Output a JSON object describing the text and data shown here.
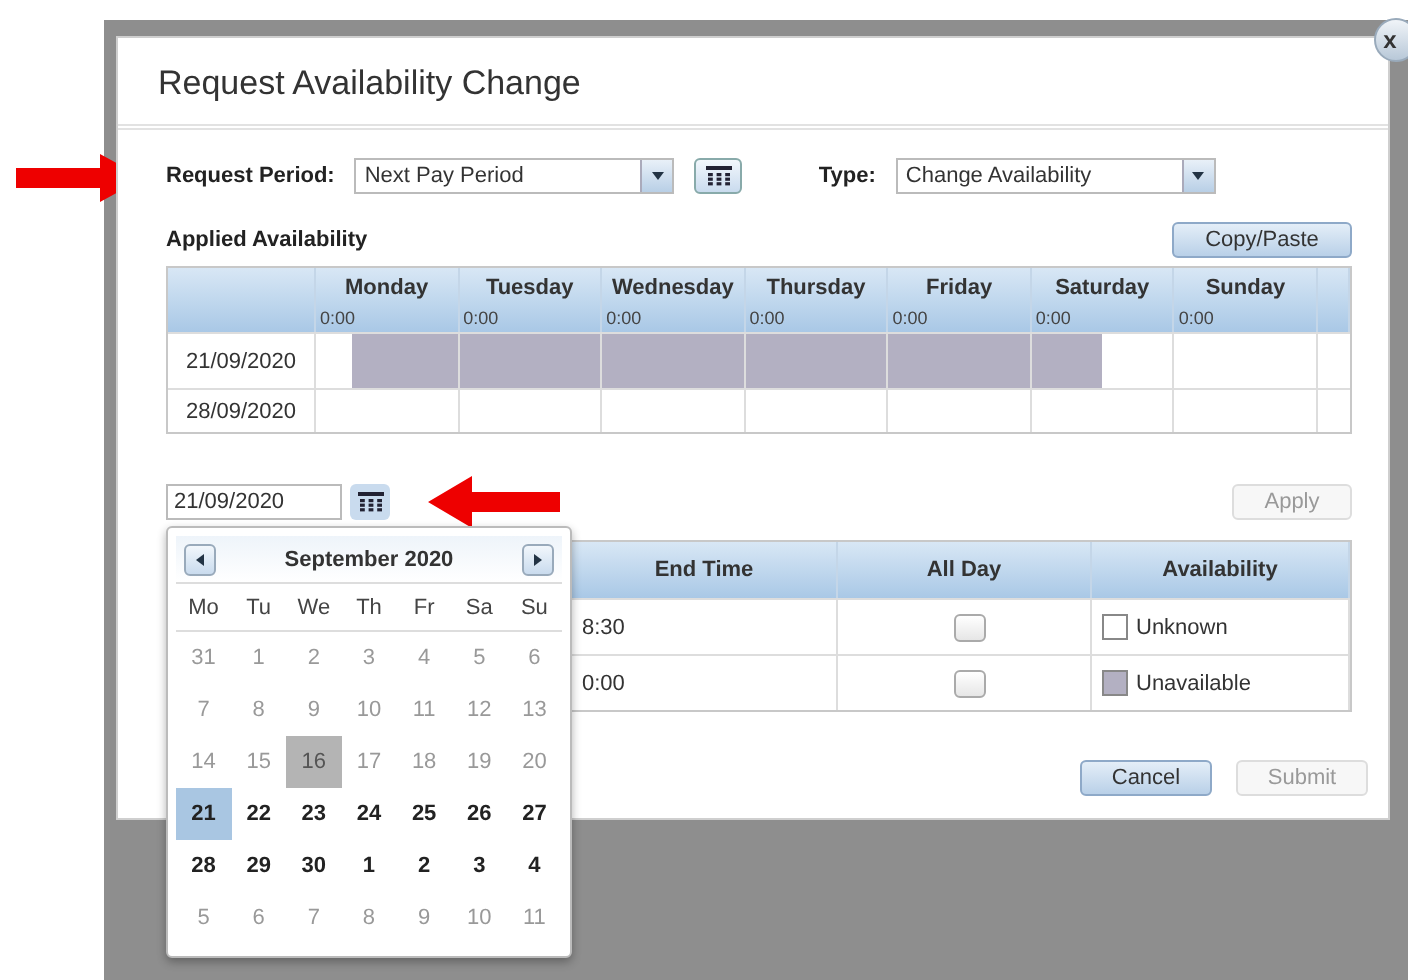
{
  "dialog": {
    "title": "Request Availability Change",
    "close": "x"
  },
  "request_period": {
    "label": "Request Period:",
    "value": "Next Pay Period"
  },
  "type": {
    "label": "Type:",
    "value": "Change Availability"
  },
  "applied": {
    "title": "Applied Availability",
    "copy_button": {
      "label": "Copy/Paste",
      "disabled": false
    },
    "days": [
      {
        "name": "Monday",
        "time": "0:00"
      },
      {
        "name": "Tuesday",
        "time": "0:00"
      },
      {
        "name": "Wednesday",
        "time": "0:00"
      },
      {
        "name": "Thursday",
        "time": "0:00"
      },
      {
        "name": "Friday",
        "time": "0:00"
      },
      {
        "name": "Saturday",
        "time": "0:00"
      },
      {
        "name": "Sunday",
        "time": "0:00"
      }
    ],
    "rows": [
      {
        "date": "21/09/2020",
        "days": [
          {
            "unavailable": [
              false,
              true,
              true,
              true
            ]
          },
          {
            "unavailable": [
              true,
              true,
              true,
              true
            ]
          },
          {
            "unavailable": [
              true,
              true,
              true,
              true
            ]
          },
          {
            "unavailable": [
              true,
              true,
              true,
              true
            ]
          },
          {
            "unavailable": [
              true,
              true,
              true,
              true
            ]
          },
          {
            "unavailable": [
              true,
              true,
              false,
              false
            ]
          },
          {
            "unavailable": [
              false,
              false,
              false,
              false
            ]
          }
        ]
      },
      {
        "date": "28/09/2020",
        "days": [
          {
            "unavailable": [
              false,
              false,
              false,
              false
            ]
          },
          {
            "unavailable": [
              false,
              false,
              false,
              false
            ]
          },
          {
            "unavailable": [
              false,
              false,
              false,
              false
            ]
          },
          {
            "unavailable": [
              false,
              false,
              false,
              false
            ]
          },
          {
            "unavailable": [
              false,
              false,
              false,
              false
            ]
          },
          {
            "unavailable": [
              false,
              false,
              false,
              false
            ]
          },
          {
            "unavailable": [
              false,
              false,
              false,
              false
            ]
          }
        ]
      }
    ]
  },
  "date_field": {
    "value": "21/09/2020"
  },
  "apply_button": {
    "label": "Apply",
    "disabled": true
  },
  "calendar": {
    "month": "September 2020",
    "weekdays": [
      "Mo",
      "Tu",
      "We",
      "Th",
      "Fr",
      "Sa",
      "Su"
    ],
    "weeks": [
      [
        {
          "label": "31",
          "kind": "dim",
          "selected": false,
          "today": false
        },
        {
          "label": "1",
          "kind": "dim",
          "selected": false,
          "today": false
        },
        {
          "label": "2",
          "kind": "dim",
          "selected": false,
          "today": false
        },
        {
          "label": "3",
          "kind": "dim",
          "selected": false,
          "today": false
        },
        {
          "label": "4",
          "kind": "dim",
          "selected": false,
          "today": false
        },
        {
          "label": "5",
          "kind": "dim",
          "selected": false,
          "today": false
        },
        {
          "label": "6",
          "kind": "dim",
          "selected": false,
          "today": false
        }
      ],
      [
        {
          "label": "7",
          "kind": "dim",
          "selected": false,
          "today": false
        },
        {
          "label": "8",
          "kind": "dim",
          "selected": false,
          "today": false
        },
        {
          "label": "9",
          "kind": "dim",
          "selected": false,
          "today": false
        },
        {
          "label": "10",
          "kind": "dim",
          "selected": false,
          "today": false
        },
        {
          "label": "11",
          "kind": "dim",
          "selected": false,
          "today": false
        },
        {
          "label": "12",
          "kind": "dim",
          "selected": false,
          "today": false
        },
        {
          "label": "13",
          "kind": "dim",
          "selected": false,
          "today": false
        }
      ],
      [
        {
          "label": "14",
          "kind": "dim",
          "selected": false,
          "today": false
        },
        {
          "label": "15",
          "kind": "dim",
          "selected": false,
          "today": false
        },
        {
          "label": "16",
          "kind": "dim",
          "selected": false,
          "today": true
        },
        {
          "label": "17",
          "kind": "dim",
          "selected": false,
          "today": false
        },
        {
          "label": "18",
          "kind": "dim",
          "selected": false,
          "today": false
        },
        {
          "label": "19",
          "kind": "dim",
          "selected": false,
          "today": false
        },
        {
          "label": "20",
          "kind": "dim",
          "selected": false,
          "today": false
        }
      ],
      [
        {
          "label": "21",
          "kind": "open",
          "selected": true,
          "today": false
        },
        {
          "label": "22",
          "kind": "open",
          "selected": false,
          "today": false
        },
        {
          "label": "23",
          "kind": "open",
          "selected": false,
          "today": false
        },
        {
          "label": "24",
          "kind": "open",
          "selected": false,
          "today": false
        },
        {
          "label": "25",
          "kind": "open",
          "selected": false,
          "today": false
        },
        {
          "label": "26",
          "kind": "open",
          "selected": false,
          "today": false
        },
        {
          "label": "27",
          "kind": "open",
          "selected": false,
          "today": false
        }
      ],
      [
        {
          "label": "28",
          "kind": "open",
          "selected": false,
          "today": false
        },
        {
          "label": "29",
          "kind": "open",
          "selected": false,
          "today": false
        },
        {
          "label": "30",
          "kind": "open",
          "selected": false,
          "today": false
        },
        {
          "label": "1",
          "kind": "open",
          "selected": false,
          "today": false
        },
        {
          "label": "2",
          "kind": "open",
          "selected": false,
          "today": false
        },
        {
          "label": "3",
          "kind": "open",
          "selected": false,
          "today": false
        },
        {
          "label": "4",
          "kind": "open",
          "selected": false,
          "today": false
        }
      ],
      [
        {
          "label": "5",
          "kind": "dim",
          "selected": false,
          "today": false
        },
        {
          "label": "6",
          "kind": "dim",
          "selected": false,
          "today": false
        },
        {
          "label": "7",
          "kind": "dim",
          "selected": false,
          "today": false
        },
        {
          "label": "8",
          "kind": "dim",
          "selected": false,
          "today": false
        },
        {
          "label": "9",
          "kind": "dim",
          "selected": false,
          "today": false
        },
        {
          "label": "10",
          "kind": "dim",
          "selected": false,
          "today": false
        },
        {
          "label": "11",
          "kind": "dim",
          "selected": false,
          "today": false
        }
      ]
    ]
  },
  "shifts": {
    "columns": [
      "End Time",
      "All Day",
      "Availability"
    ],
    "rows": [
      {
        "end_time": "8:30",
        "all_day": false,
        "availability": "Unknown",
        "unavailable": false
      },
      {
        "end_time": "0:00",
        "all_day": false,
        "availability": "Unavailable",
        "unavailable": true
      }
    ]
  },
  "buttons": [
    {
      "label": "Cancel",
      "disabled": false
    },
    {
      "label": "Submit",
      "disabled": true
    }
  ]
}
